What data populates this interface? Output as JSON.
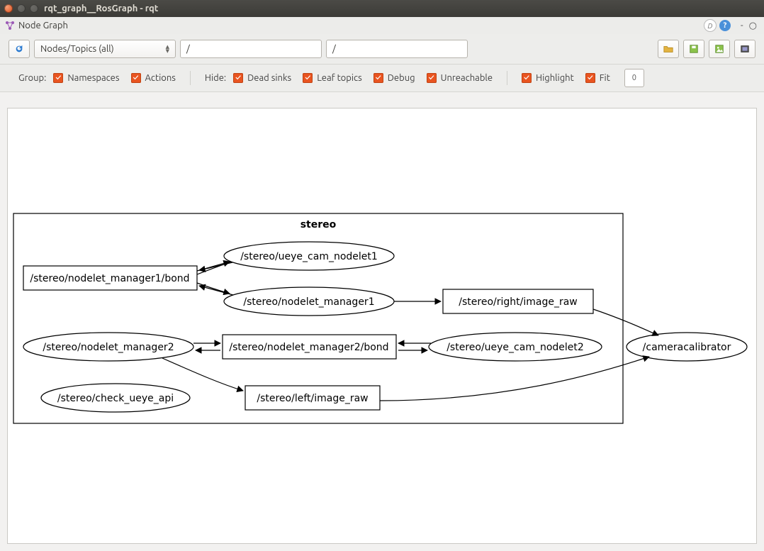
{
  "window": {
    "title": "rqt_graph__RosGraph - rqt"
  },
  "panel": {
    "title": "Node Graph"
  },
  "toolbar": {
    "refresh_icon": "refresh-icon",
    "mode_selector": "Nodes/Topics (all)",
    "filter1": "/",
    "filter2": "/",
    "buttons": {
      "load": "load-icon",
      "save": "save-icon",
      "save_as": "save-as-icon",
      "image": "image-icon"
    }
  },
  "options": {
    "group_label": "Group:",
    "group": [
      {
        "label": "Namespaces",
        "checked": true
      },
      {
        "label": "Actions",
        "checked": true
      }
    ],
    "hide_label": "Hide:",
    "hide": [
      {
        "label": "Dead sinks",
        "checked": true
      },
      {
        "label": "Leaf topics",
        "checked": true
      },
      {
        "label": "Debug",
        "checked": true
      },
      {
        "label": "Unreachable",
        "checked": true
      }
    ],
    "extra": [
      {
        "label": "Highlight",
        "checked": true
      },
      {
        "label": "Fit",
        "checked": true
      }
    ],
    "depth": "0"
  },
  "graph": {
    "cluster": {
      "label": "stereo"
    },
    "nodes": {
      "ueye1": {
        "label": "/stereo/ueye_cam_nodelet1",
        "shape": "ellipse"
      },
      "nm1bond": {
        "label": "/stereo/nodelet_manager1/bond",
        "shape": "rect"
      },
      "nm1": {
        "label": "/stereo/nodelet_manager1",
        "shape": "ellipse"
      },
      "right": {
        "label": "/stereo/right/image_raw",
        "shape": "rect"
      },
      "nm2": {
        "label": "/stereo/nodelet_manager2",
        "shape": "ellipse"
      },
      "nm2bond": {
        "label": "/stereo/nodelet_manager2/bond",
        "shape": "rect"
      },
      "ueye2": {
        "label": "/stereo/ueye_cam_nodelet2",
        "shape": "ellipse"
      },
      "check": {
        "label": "/stereo/check_ueye_api",
        "shape": "ellipse"
      },
      "left": {
        "label": "/stereo/left/image_raw",
        "shape": "rect"
      },
      "calib": {
        "label": "/cameracalibrator",
        "shape": "ellipse"
      }
    }
  }
}
